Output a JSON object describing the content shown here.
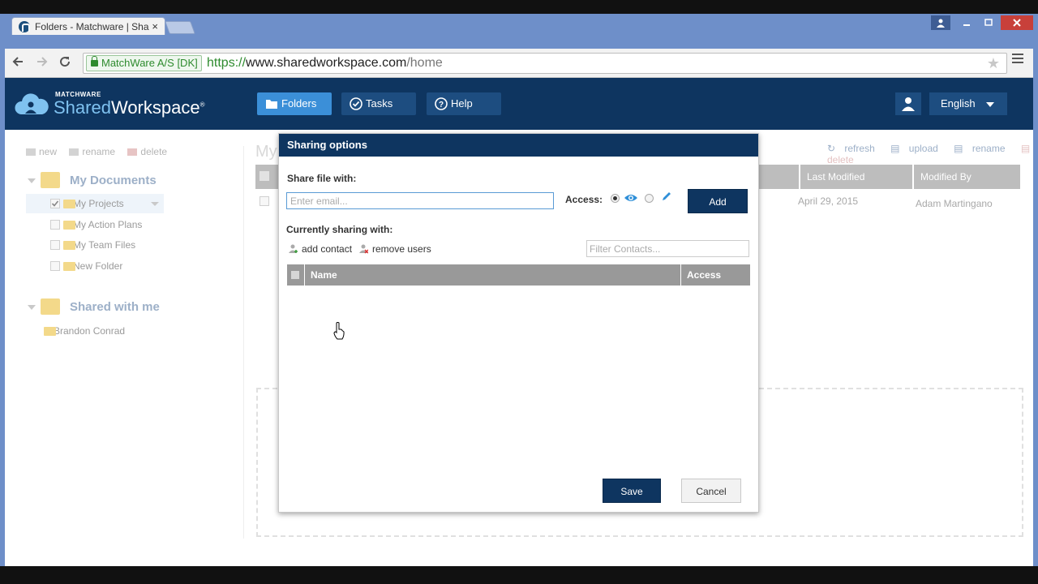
{
  "browser": {
    "tab_title": "Folders - Matchware | Sha",
    "tab_close": "×",
    "ev_label": "MatchWare A/S [DK]",
    "url_scheme": "https://",
    "url_host": "www.sharedworkspace.com",
    "url_path": "/home"
  },
  "app": {
    "logo_small": "MATCHWARE",
    "logo_shared": "Shared",
    "logo_workspace": "Workspace",
    "logo_mark": "®",
    "nav": {
      "folders": "Folders",
      "tasks": "Tasks",
      "help": "Help"
    },
    "language": "English"
  },
  "sidebar": {
    "actions": {
      "new": "new",
      "rename": "rename",
      "delete": "delete"
    },
    "my_documents": "My Documents",
    "items": [
      {
        "label": "My Projects",
        "checked": true
      },
      {
        "label": "My Action Plans",
        "checked": false
      },
      {
        "label": "My Team Files",
        "checked": false
      },
      {
        "label": "New Folder",
        "checked": false
      }
    ],
    "shared_with_me": "Shared with me",
    "shared_items": [
      {
        "label": "Brandon Conrad"
      }
    ]
  },
  "main": {
    "title_partial": "My",
    "actions": {
      "refresh": "refresh",
      "upload": "upload",
      "rename": "rename",
      "delete": "delete"
    },
    "columns": {
      "last_modified": "Last Modified",
      "modified_by": "Modified By"
    },
    "row": {
      "last_modified": "April 29, 2015",
      "modified_by": "Adam Martingano"
    }
  },
  "dialog": {
    "title": "Sharing options",
    "share_label": "Share file with:",
    "email_placeholder": "Enter email...",
    "access_label": "Access:",
    "add_button": "Add",
    "currently_sharing": "Currently sharing with:",
    "add_contact": "add contact",
    "remove_users": "remove users",
    "filter_placeholder": "Filter Contacts...",
    "columns": {
      "name": "Name",
      "access": "Access"
    },
    "save_button": "Save",
    "cancel_button": "Cancel"
  },
  "colors": {
    "app_header": "#0e3560",
    "nav_active": "#3b8fd8",
    "browser_frame": "#6e8fc9"
  }
}
